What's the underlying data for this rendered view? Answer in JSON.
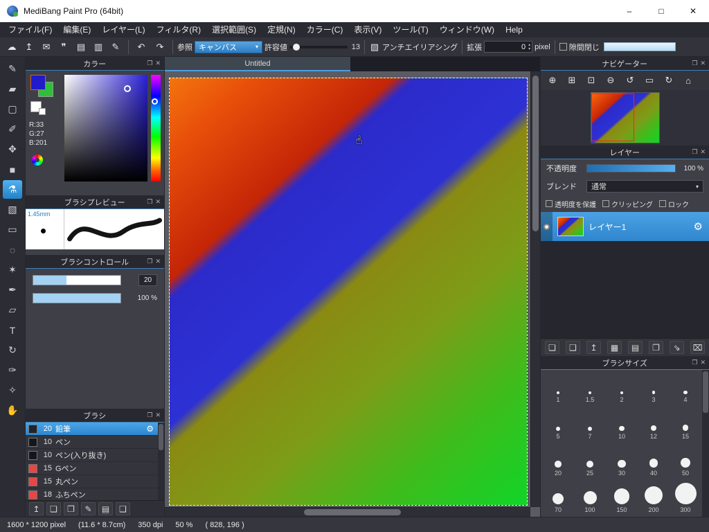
{
  "window": {
    "title": "MediBang Paint Pro (64bit)",
    "minimize_glyph": "–",
    "maximize_glyph": "□",
    "close_glyph": "✕"
  },
  "menu": [
    {
      "name": "menu-file",
      "label": "ファイル(F)"
    },
    {
      "name": "menu-edit",
      "label": "編集(E)"
    },
    {
      "name": "menu-layer",
      "label": "レイヤー(L)"
    },
    {
      "name": "menu-filter",
      "label": "フィルタ(R)"
    },
    {
      "name": "menu-select",
      "label": "選択範囲(S)"
    },
    {
      "name": "menu-ruler",
      "label": "定規(N)"
    },
    {
      "name": "menu-color",
      "label": "カラー(C)"
    },
    {
      "name": "menu-view",
      "label": "表示(V)"
    },
    {
      "name": "menu-tool",
      "label": "ツール(T)"
    },
    {
      "name": "menu-window",
      "label": "ウィンドウ(W)"
    },
    {
      "name": "menu-help",
      "label": "Help"
    }
  ],
  "toolbar": {
    "icons": [
      {
        "name": "cloud-icon",
        "glyph": "☁"
      },
      {
        "name": "publish-icon",
        "glyph": "↥"
      },
      {
        "name": "comment-icon",
        "glyph": "✉"
      },
      {
        "name": "message-icon",
        "glyph": "❞"
      },
      {
        "name": "document-icon",
        "glyph": "▤"
      },
      {
        "name": "document-list-icon",
        "glyph": "▥"
      },
      {
        "name": "edit-post-icon",
        "glyph": "✎"
      }
    ],
    "undo_glyph": "↶",
    "redo_glyph": "↷",
    "reference_label": "参照",
    "reference_value": "キャンバス",
    "tolerance_label": "許容値",
    "tolerance_value": "13",
    "antialias_icon_glyph": "▨",
    "antialias_label": "アンチエイリアシング",
    "expand_label": "拡張",
    "expand_value": "0",
    "expand_unit": "pixel",
    "gap_close_label": "隙間閉じ"
  },
  "tools": [
    {
      "name": "pen-tool",
      "glyph": "✎"
    },
    {
      "name": "eraser-tool",
      "glyph": "▰"
    },
    {
      "name": "figure-tool",
      "glyph": "▢"
    },
    {
      "name": "dot-pen-tool",
      "glyph": "✐"
    },
    {
      "name": "move-tool",
      "glyph": "✥"
    },
    {
      "name": "fill-shape-tool",
      "glyph": "■"
    },
    {
      "name": "bucket-tool",
      "glyph": "⚗",
      "active": true
    },
    {
      "name": "gradient-tool",
      "glyph": "▧"
    },
    {
      "name": "select-tool",
      "glyph": "▭"
    },
    {
      "name": "lasso-select-tool",
      "glyph": "◌"
    },
    {
      "name": "magic-wand-tool",
      "glyph": "✶"
    },
    {
      "name": "select-pen-tool",
      "glyph": "✒"
    },
    {
      "name": "select-eraser-tool",
      "glyph": "▱"
    },
    {
      "name": "text-tool",
      "glyph": "T"
    },
    {
      "name": "operation-tool",
      "glyph": "↻"
    },
    {
      "name": "brush-tool",
      "glyph": "✑"
    },
    {
      "name": "eyedropper-tool",
      "glyph": "✧"
    },
    {
      "name": "hand-tool",
      "glyph": "✋"
    }
  ],
  "panel_chrome": {
    "popout_glyph": "❐",
    "close_glyph": "✕"
  },
  "panels": {
    "color": {
      "title": "カラー",
      "r": "R:33",
      "g": "G:27",
      "b": "B:201",
      "foreground": "#211bc9",
      "background_swatch": "#2ebf3a"
    },
    "brush_preview": {
      "title": "ブラシプレビュー",
      "size_label": "1.45mm"
    },
    "brush_control": {
      "title": "ブラシコントロール",
      "size_value": "20",
      "opacity_value": "100 %",
      "size_fill_pct": 38
    },
    "brush": {
      "title": "ブラシ",
      "gear_glyph": "⚙",
      "items": [
        {
          "size": "20",
          "name": "鉛筆",
          "swatch": "#20242c",
          "selected": true
        },
        {
          "size": "10",
          "name": "ペン",
          "swatch": "#14161c"
        },
        {
          "size": "10",
          "name": "ペン(入り抜き)",
          "swatch": "#14161c"
        },
        {
          "size": "15",
          "name": "Gペン",
          "swatch": "#e84545"
        },
        {
          "size": "15",
          "name": "丸ペン",
          "swatch": "#e84545"
        },
        {
          "size": "18",
          "name": "ふちペン",
          "swatch": "#e84545"
        }
      ],
      "bottom_icons": [
        {
          "name": "upload-brush-icon",
          "glyph": "↥"
        },
        {
          "name": "add-brush-icon",
          "glyph": "❏"
        },
        {
          "name": "add-brush-menu-icon",
          "glyph": "❐"
        },
        {
          "name": "edit-brush-icon",
          "glyph": "✎"
        },
        {
          "name": "brush-folder-icon",
          "glyph": "▤"
        },
        {
          "name": "duplicate-brush-icon",
          "glyph": "❑"
        }
      ]
    },
    "navigator": {
      "title": "ナビゲーター",
      "icons": [
        {
          "name": "zoom-in-icon",
          "glyph": "⊕"
        },
        {
          "name": "zoom-step-icon",
          "glyph": "⊞"
        },
        {
          "name": "fit-window-icon",
          "glyph": "⊡"
        },
        {
          "name": "zoom-out-icon",
          "glyph": "⊖"
        },
        {
          "name": "rotate-ccw-icon",
          "glyph": "↺"
        },
        {
          "name": "view-area-icon",
          "glyph": "▭"
        },
        {
          "name": "rotate-cw-icon",
          "glyph": "↻"
        },
        {
          "name": "reset-view-icon",
          "glyph": "⌂"
        }
      ]
    },
    "layer": {
      "title": "レイヤー",
      "opacity_label": "不透明度",
      "opacity_value": "100 %",
      "blend_label": "ブレンド",
      "blend_value": "通常",
      "gear_glyph": "⚙",
      "checkboxes": [
        {
          "name": "protect-alpha-checkbox",
          "label": "透明度を保護"
        },
        {
          "name": "clipping-checkbox",
          "label": "クリッピング"
        },
        {
          "name": "lock-checkbox",
          "label": "ロック"
        }
      ],
      "layers": [
        {
          "name": "レイヤー1",
          "selected": true
        }
      ],
      "bottom_icons": [
        {
          "name": "add-layer-icon",
          "glyph": "❏"
        },
        {
          "name": "duplicate-layer-icon",
          "glyph": "❑"
        },
        {
          "name": "import-layer-icon",
          "glyph": "↥"
        },
        {
          "name": "halftone-layer-icon",
          "glyph": "▦"
        },
        {
          "name": "layer-folder-icon",
          "glyph": "▤"
        },
        {
          "name": "copy-layer-icon",
          "glyph": "❐"
        },
        {
          "name": "merge-down-icon",
          "glyph": "⇘"
        },
        {
          "name": "delete-layer-icon",
          "glyph": "⌧"
        }
      ]
    },
    "brush_size": {
      "title": "ブラシサイズ",
      "sizes": [
        1,
        1.5,
        2,
        3,
        4,
        5,
        7,
        10,
        12,
        15,
        20,
        25,
        30,
        40,
        50,
        70,
        100,
        150,
        200,
        300
      ]
    }
  },
  "canvas": {
    "tab": "Untitled",
    "cursor_glyph": "☝"
  },
  "status": {
    "size": "1600 * 1200 pixel",
    "dimensions": "(11.6 * 8.7cm)",
    "dpi": "350 dpi",
    "zoom": "50 %",
    "coords": "( 828, 196 )"
  },
  "colors": {
    "accent": "#3a93d8",
    "foreground_color": "#211bc9",
    "selection": "#2f86cd"
  }
}
